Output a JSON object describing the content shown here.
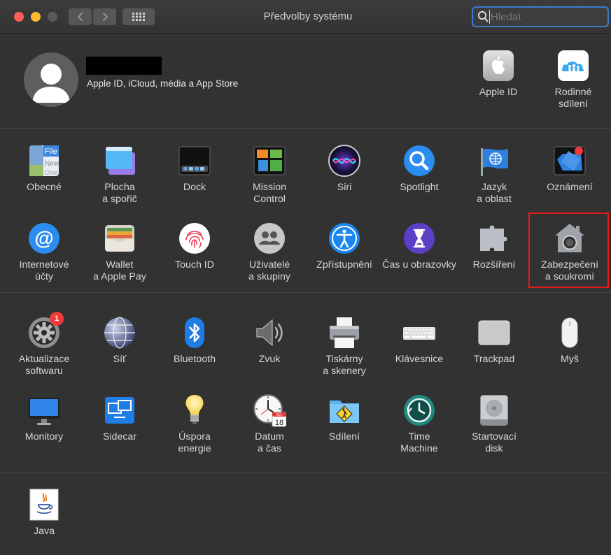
{
  "window": {
    "title": "Předvolby systému"
  },
  "search": {
    "placeholder": "Hledat"
  },
  "account": {
    "subtitle": "Apple ID, iCloud, média a App Store",
    "items": [
      {
        "label": "Apple ID",
        "icon": "apple-id-icon"
      },
      {
        "label": "Rodinné\nsdílení",
        "icon": "family-sharing-icon"
      }
    ]
  },
  "section1": [
    {
      "label": "Obecné",
      "icon": "general-icon"
    },
    {
      "label": "Plocha\na spořič",
      "icon": "desktop-screensaver-icon"
    },
    {
      "label": "Dock",
      "icon": "dock-icon"
    },
    {
      "label": "Mission\nControl",
      "icon": "mission-control-icon"
    },
    {
      "label": "Siri",
      "icon": "siri-icon"
    },
    {
      "label": "Spotlight",
      "icon": "spotlight-icon"
    },
    {
      "label": "Jazyk\na oblast",
      "icon": "language-region-icon"
    },
    {
      "label": "Oznámení",
      "icon": "notifications-icon"
    },
    {
      "label": "Internetové\núčty",
      "icon": "internet-accounts-icon"
    },
    {
      "label": "Wallet\na Apple Pay",
      "icon": "wallet-icon"
    },
    {
      "label": "Touch ID",
      "icon": "touch-id-icon"
    },
    {
      "label": "Uživatelé\na skupiny",
      "icon": "users-groups-icon"
    },
    {
      "label": "Zpřístupnění",
      "icon": "accessibility-icon"
    },
    {
      "label": "Čas u obrazovky",
      "icon": "screen-time-icon"
    },
    {
      "label": "Rozšíření",
      "icon": "extensions-icon"
    },
    {
      "label": "Zabezpečení\na soukromí",
      "icon": "security-privacy-icon"
    }
  ],
  "section2": [
    {
      "label": "Aktualizace\nsoftwaru",
      "icon": "software-update-icon",
      "badge": "1"
    },
    {
      "label": "Síť",
      "icon": "network-icon"
    },
    {
      "label": "Bluetooth",
      "icon": "bluetooth-icon"
    },
    {
      "label": "Zvuk",
      "icon": "sound-icon"
    },
    {
      "label": "Tiskárny\na skenery",
      "icon": "printer-icon"
    },
    {
      "label": "Klávesnice",
      "icon": "keyboard-icon"
    },
    {
      "label": "Trackpad",
      "icon": "trackpad-icon"
    },
    {
      "label": "Myš",
      "icon": "mouse-icon"
    },
    {
      "label": "Monitory",
      "icon": "displays-icon"
    },
    {
      "label": "Sidecar",
      "icon": "sidecar-icon"
    },
    {
      "label": "Úspora\nenergie",
      "icon": "energy-saver-icon"
    },
    {
      "label": "Datum\na čas",
      "icon": "date-time-icon",
      "calendar_month": "JUL",
      "calendar_day": "18"
    },
    {
      "label": "Sdílení",
      "icon": "sharing-icon"
    },
    {
      "label": "Time\nMachine",
      "icon": "time-machine-icon"
    },
    {
      "label": "Startovací\ndisk",
      "icon": "startup-disk-icon"
    }
  ],
  "section3": [
    {
      "label": "Java",
      "icon": "java-icon"
    }
  ],
  "general_icon_text": [
    "File",
    "New",
    "One"
  ],
  "colors": {
    "accent": "#3c7bd1",
    "selection": "#e31b1b",
    "background": "#323232"
  }
}
